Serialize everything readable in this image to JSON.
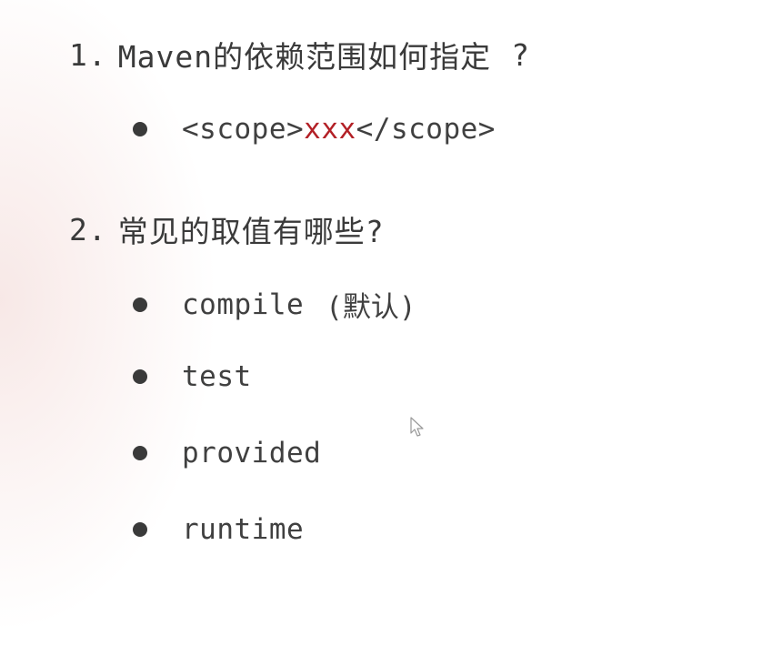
{
  "questions": [
    {
      "number": "1.",
      "text": "Maven的依赖范围如何指定",
      "mark": "?",
      "answer": {
        "open": "<scope>",
        "value": "xxx",
        "close": "</scope>"
      }
    },
    {
      "number": "2.",
      "text": "常见的取值有哪些?",
      "options": [
        {
          "label": "compile",
          "note": "(默认)"
        },
        {
          "label": "test"
        },
        {
          "label": "provided"
        },
        {
          "label": "runtime"
        }
      ]
    }
  ],
  "colors": {
    "text": "#3e3e3e",
    "accent": "#b32026"
  },
  "icons": {
    "bullet": "bullet-dot-icon",
    "cursor": "mouse-pointer-icon"
  }
}
